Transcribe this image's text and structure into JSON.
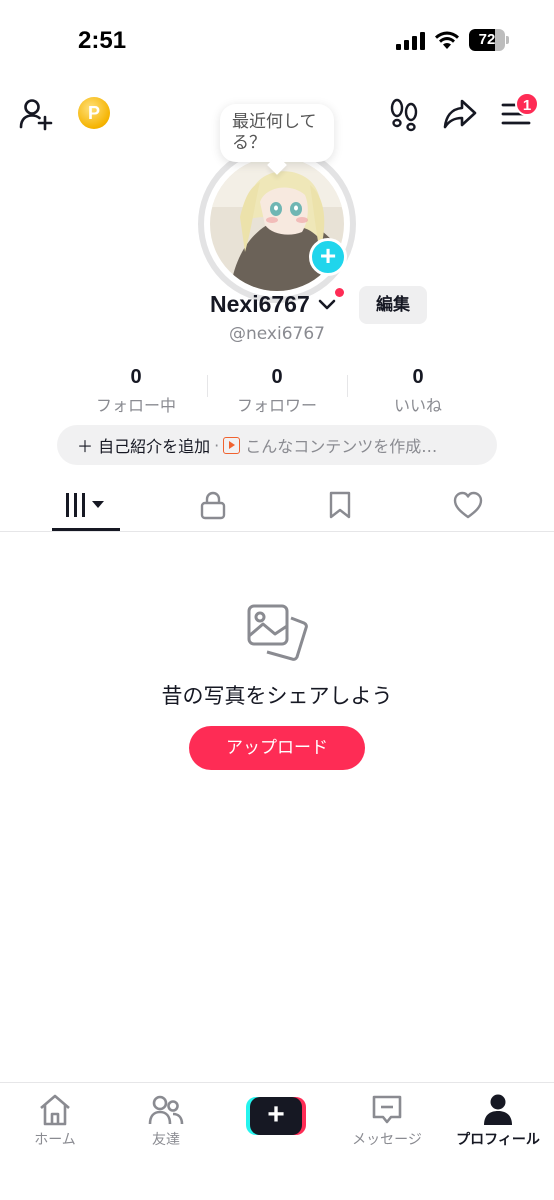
{
  "status_bar": {
    "time": "2:51",
    "battery": "72",
    "battery_level": 0.72
  },
  "header": {
    "coin_label": "P",
    "menu_badge": "1"
  },
  "profile": {
    "bubble_text": "最近何してる？",
    "name": "Nexi6767",
    "username": "@nexi6767",
    "edit_label": "編集",
    "avatar_plus": "+"
  },
  "stats": [
    {
      "value": "0",
      "label": "フォロー中"
    },
    {
      "value": "0",
      "label": "フォロワー"
    },
    {
      "value": "0",
      "label": "いいね"
    }
  ],
  "bio": {
    "add_label": "＋ 自己紹介を追加",
    "separator": "·",
    "hint": "こんなコンテンツを作成…"
  },
  "tabs": [
    "videos-grid",
    "private-lock",
    "bookmarks",
    "likes-heart"
  ],
  "empty_state": {
    "title": "昔の写真をシェアしよう",
    "button": "アップロード"
  },
  "bottom_nav": {
    "items": [
      {
        "label": "ホーム",
        "icon": "home-icon"
      },
      {
        "label": "友達",
        "icon": "friends-icon"
      },
      {
        "label": "+",
        "icon": "create-icon"
      },
      {
        "label": "メッセージ",
        "icon": "inbox-icon"
      },
      {
        "label": "プロフィール",
        "icon": "profile-icon",
        "active": true
      }
    ]
  },
  "colors": {
    "accent": "#fe2c55",
    "cyan": "#25f4ee",
    "text": "#161823",
    "muted": "#8a8b91"
  }
}
